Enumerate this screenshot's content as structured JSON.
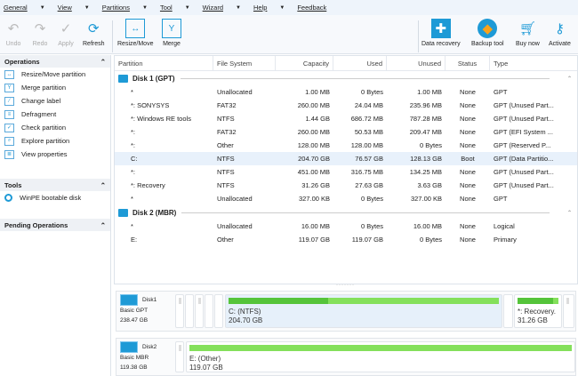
{
  "menu": [
    "General",
    "View",
    "Partitions",
    "Tool",
    "Wizard",
    "Help",
    "Feedback"
  ],
  "toolbar": {
    "undo": "Undo",
    "redo": "Redo",
    "apply": "Apply",
    "refresh": "Refresh",
    "resize": "Resize/Move",
    "merge": "Merge",
    "data_recovery": "Data recovery",
    "backup": "Backup tool",
    "buy": "Buy now",
    "activate": "Activate"
  },
  "sidebar": {
    "operations_title": "Operations",
    "operations": [
      "Resize/Move partition",
      "Merge partition",
      "Change label",
      "Defragment",
      "Check partition",
      "Explore partition",
      "View properties"
    ],
    "tools_title": "Tools",
    "tools": [
      "WinPE bootable disk"
    ],
    "pending_title": "Pending Operations"
  },
  "table": {
    "headers": [
      "Partition",
      "File System",
      "Capacity",
      "Used",
      "Unused",
      "Status",
      "Type"
    ],
    "disk1": "Disk 1 (GPT)",
    "disk2": "Disk 2 (MBR)",
    "disk1_rows": [
      [
        "*",
        "Unallocated",
        "1.00 MB",
        "0 Bytes",
        "1.00 MB",
        "None",
        "GPT"
      ],
      [
        "*: SONYSYS",
        "FAT32",
        "260.00 MB",
        "24.04 MB",
        "235.96 MB",
        "None",
        "GPT (Unused Part..."
      ],
      [
        "*: Windows RE tools",
        "NTFS",
        "1.44 GB",
        "686.72 MB",
        "787.28 MB",
        "None",
        "GPT (Unused Part..."
      ],
      [
        "*:",
        "FAT32",
        "260.00 MB",
        "50.53 MB",
        "209.47 MB",
        "None",
        "GPT (EFI System ..."
      ],
      [
        "*:",
        "Other",
        "128.00 MB",
        "128.00 MB",
        "0 Bytes",
        "None",
        "GPT (Reserved P..."
      ],
      [
        "C:",
        "NTFS",
        "204.70 GB",
        "76.57 GB",
        "128.13 GB",
        "Boot",
        "GPT (Data Partitio..."
      ],
      [
        "*:",
        "NTFS",
        "451.00 MB",
        "316.75 MB",
        "134.25 MB",
        "None",
        "GPT (Unused Part..."
      ],
      [
        "*: Recovery",
        "NTFS",
        "31.26 GB",
        "27.63 GB",
        "3.63 GB",
        "None",
        "GPT (Unused Part..."
      ],
      [
        "*",
        "Unallocated",
        "327.00 KB",
        "0 Bytes",
        "327.00 KB",
        "None",
        "GPT"
      ]
    ],
    "disk2_rows": [
      [
        "*",
        "Unallocated",
        "16.00 MB",
        "0 Bytes",
        "16.00 MB",
        "None",
        "Logical"
      ],
      [
        "E:",
        "Other",
        "119.07 GB",
        "119.07 GB",
        "0 Bytes",
        "None",
        "Primary"
      ]
    ]
  },
  "diskmap": {
    "disk1": {
      "name": "Disk1",
      "type": "Basic GPT",
      "size": "238.47 GB",
      "c_label": "C: (NTFS)",
      "c_size": "204.70 GB",
      "c_used_pct": 37,
      "rec_label": "*: Recovery.",
      "rec_size": "31.26 GB",
      "rec_used_pct": 88
    },
    "disk2": {
      "name": "Disk2",
      "type": "Basic MBR",
      "size": "119.38 GB",
      "e_label": "E: (Other)",
      "e_size": "119.07 GB",
      "e_used_pct": 100
    }
  }
}
